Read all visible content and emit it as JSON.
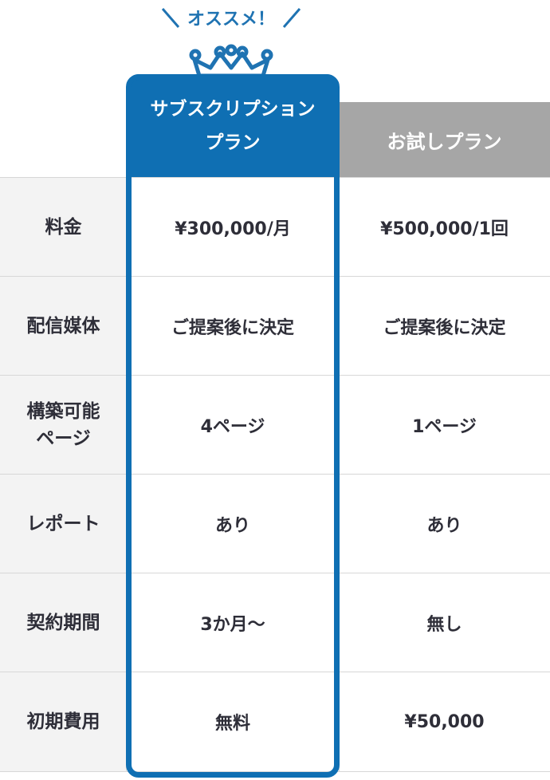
{
  "badge": {
    "text": "オススメ！"
  },
  "plans": [
    {
      "name_line1": "サブスクリプション",
      "name_line2": "プラン",
      "recommended": true
    },
    {
      "name": "お試しプラン",
      "recommended": false
    }
  ],
  "rows": [
    {
      "label": "料金",
      "subscription": "¥300,000/月",
      "trial": "¥500,000/1回"
    },
    {
      "label": "配信媒体",
      "subscription": "ご提案後に決定",
      "trial": "ご提案後に決定"
    },
    {
      "label_line1": "構築可能",
      "label_line2": "ページ",
      "subscription": "4ページ",
      "trial": "1ページ"
    },
    {
      "label": "レポート",
      "subscription": "あり",
      "trial": "あり"
    },
    {
      "label": "契約期間",
      "subscription": "3か月〜",
      "trial": "無し"
    },
    {
      "label": "初期費用",
      "subscription": "無料",
      "trial": "¥50,000"
    }
  ],
  "colors": {
    "accent": "#0f6fb3",
    "trial_header": "#a6a6a6",
    "label_bg": "#f3f3f3"
  }
}
